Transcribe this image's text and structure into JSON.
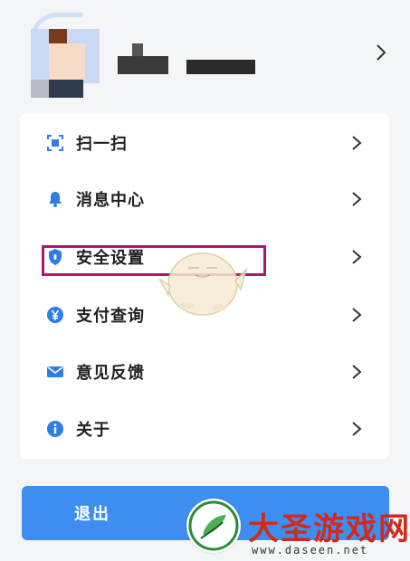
{
  "menu": {
    "items": [
      {
        "label": "扫一扫",
        "icon": "scan-icon"
      },
      {
        "label": "消息中心",
        "icon": "bell-icon"
      },
      {
        "label": "安全设置",
        "icon": "shield-icon"
      },
      {
        "label": "支付查询",
        "icon": "yuan-icon"
      },
      {
        "label": "意见反馈",
        "icon": "mail-icon"
      },
      {
        "label": "关于",
        "icon": "info-icon"
      }
    ]
  },
  "logout": {
    "label": "退出"
  },
  "watermark": {
    "brand": "大圣游戏网",
    "url": "www.daseen.net"
  },
  "colors": {
    "accent": "#3d8ef0",
    "highlight": "#b0176c",
    "brand_red": "#d12a1c"
  }
}
